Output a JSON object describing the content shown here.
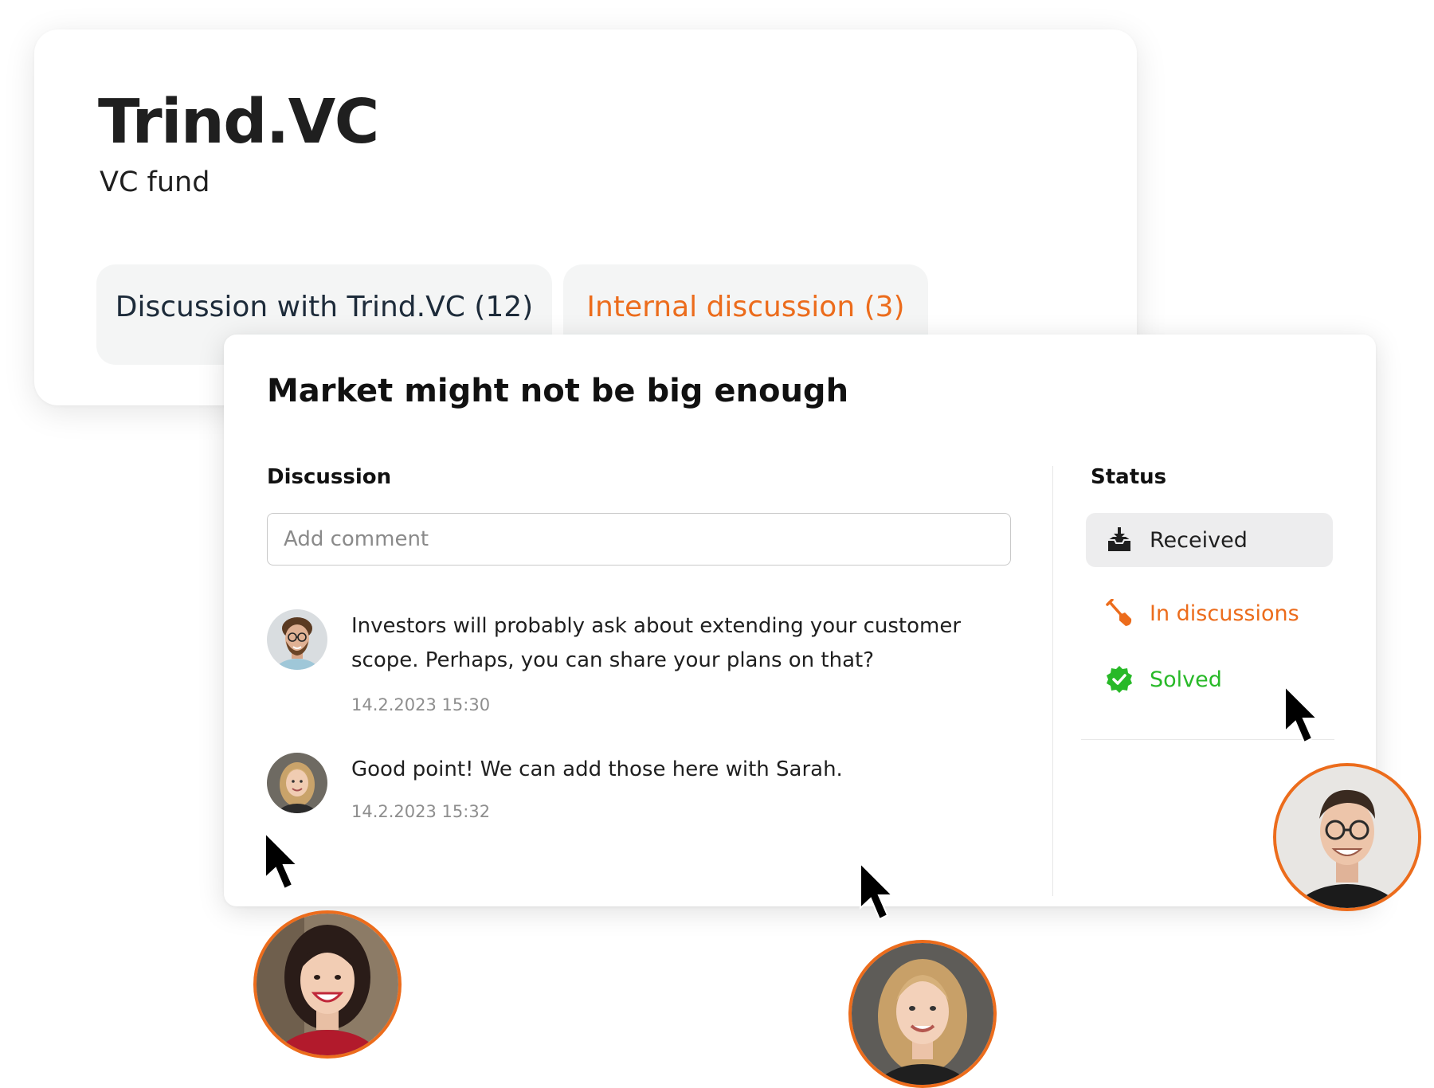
{
  "organization": {
    "name": "Trind.VC",
    "type": "VC fund",
    "tabs": [
      {
        "label": "Discussion with Trind.VC (12)",
        "color": "#1d2b3a"
      },
      {
        "label": "Internal discussion (3)",
        "color": "#ec6c1c"
      }
    ]
  },
  "issue": {
    "title": "Market might not be big enough",
    "discussion_heading": "Discussion",
    "comment_placeholder": "Add comment",
    "comments": [
      {
        "text": "Investors will probably ask about extending your customer scope. Perhaps, you can share your plans on that?",
        "timestamp": "14.2.2023 15:30",
        "avatar": "bearded-man-glasses-avatar"
      },
      {
        "text": "Good point! We can add those here with Sarah.",
        "timestamp": "14.2.2023 15:32",
        "avatar": "blonde-woman-avatar"
      }
    ],
    "status_heading": "Status",
    "statuses": [
      {
        "label": "Received",
        "icon": "inbox-tray-icon",
        "color": "#1f1f1f",
        "selected": true
      },
      {
        "label": "In discussions",
        "icon": "shovel-icon",
        "color": "#ec6c1c",
        "selected": false
      },
      {
        "label": "Solved",
        "icon": "verified-badge-icon",
        "color": "#28b928",
        "selected": false
      }
    ]
  },
  "collaborators": [
    {
      "avatar": "dark-haired-woman-avatar"
    },
    {
      "avatar": "blonde-woman-avatar"
    },
    {
      "avatar": "man-glasses-avatar"
    }
  ],
  "colors": {
    "accent": "#ec6c1c",
    "success": "#28b928",
    "text": "#1f1f1f",
    "tab_background": "#f4f5f5"
  }
}
